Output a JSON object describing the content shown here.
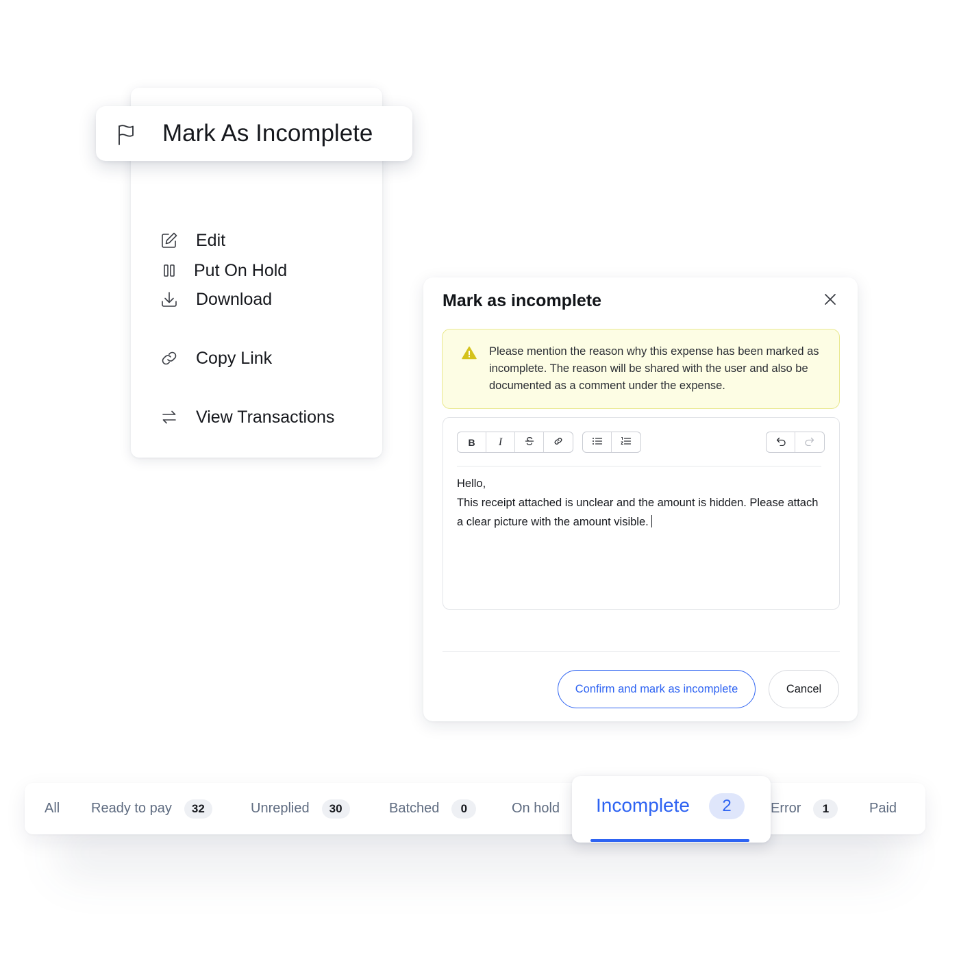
{
  "context_menu": {
    "highlighted": {
      "label": "Mark As Incomplete",
      "icon": "flag-icon"
    },
    "items": [
      {
        "label": "Put On Hold",
        "icon": "pause-icon"
      },
      {
        "label": "Edit",
        "icon": "edit-icon"
      },
      {
        "label": "Download",
        "icon": "download-icon"
      },
      {
        "label": "Copy Link",
        "icon": "link-icon"
      },
      {
        "label": "View Transactions",
        "icon": "transfer-icon"
      }
    ]
  },
  "modal": {
    "title": "Mark as incomplete",
    "close_icon": "close-icon",
    "alert": {
      "icon": "warning-icon",
      "text": "Please mention the reason why this expense has been marked as incomplete. The reason will be shared with the user and also be documented as a comment under the expense."
    },
    "toolbar": {
      "bold": "B",
      "italic": "I",
      "strikethrough_icon": "strikethrough-icon",
      "link_icon": "link-icon",
      "bullet_list_icon": "bullet-list-icon",
      "numbered_list_icon": "numbered-list-icon",
      "undo_icon": "undo-icon",
      "redo_icon": "redo-icon"
    },
    "editor": {
      "line1": "Hello,",
      "line2": "This receipt attached is unclear and the amount is hidden. Please attach a clear picture with the amount visible."
    },
    "confirm_label": "Confirm and mark as incomplete",
    "cancel_label": "Cancel"
  },
  "tabs": {
    "items": [
      {
        "label": "All"
      },
      {
        "label": "Ready to pay",
        "count": "32"
      },
      {
        "label": "Unreplied",
        "count": "30"
      },
      {
        "label": "Batched",
        "count": "0"
      },
      {
        "label": "On hold"
      },
      {
        "label": "Error",
        "count": "1"
      },
      {
        "label": "Paid"
      }
    ],
    "active": {
      "label": "Incomplete",
      "count": "2"
    }
  },
  "colors": {
    "accent": "#2e63f2",
    "alert_bg": "#fdfde4",
    "alert_border": "#e9e88f",
    "warning": "#d4c21c",
    "tab_text": "#5e6b80"
  }
}
